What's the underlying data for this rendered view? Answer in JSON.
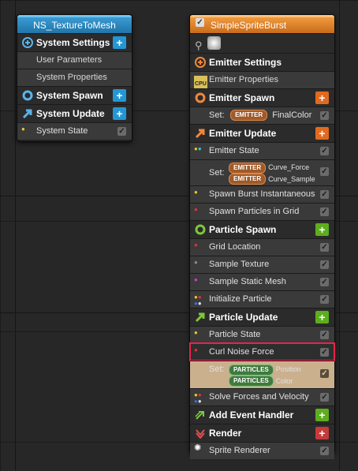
{
  "system_node": {
    "title": "NS_TextureToMesh",
    "rows": [
      {
        "kind": "header",
        "label": "System Settings",
        "icon": "system-settings-icon",
        "plus": true
      },
      {
        "kind": "plain",
        "label": "User Parameters"
      },
      {
        "kind": "plain",
        "label": "System Properties"
      },
      {
        "kind": "header",
        "label": "System Spawn",
        "icon": "system-spawn-icon",
        "plus": true
      },
      {
        "kind": "header",
        "label": "System Update",
        "icon": "system-update-icon",
        "plus": true
      },
      {
        "kind": "module",
        "label": "System State"
      }
    ]
  },
  "emitter_node": {
    "title": "SimpleSpriteBurst",
    "emitter_settings": "Emitter Settings",
    "emitter_properties": "Emitter Properties",
    "emitter_spawn": "Emitter Spawn",
    "set_label": "Set:",
    "spawn_set": {
      "badge": "EMITTER",
      "value": "FinalColor"
    },
    "emitter_update": "Emitter Update",
    "emitter_state": "Emitter State",
    "update_set": [
      {
        "badge": "EMITTER",
        "value": "Curve_Force"
      },
      {
        "badge": "EMITTER",
        "value": "Curve_Sample"
      }
    ],
    "spawn_burst": "Spawn Burst Instantaneous",
    "spawn_grid": "Spawn Particles in Grid",
    "particle_spawn": "Particle Spawn",
    "grid_location": "Grid Location",
    "sample_texture": "Sample Texture",
    "sample_static_mesh": "Sample Static Mesh",
    "initialize_particle": "Initialize Particle",
    "particle_update": "Particle Update",
    "particle_state": "Particle State",
    "curl_noise": "Curl Noise Force",
    "particles_set": [
      {
        "badge": "PARTICLES",
        "value": "Position"
      },
      {
        "badge": "PARTICLES",
        "value": "Color"
      }
    ],
    "solve_forces": "Solve Forces and Velocity",
    "add_event_handler": "Add Event Handler",
    "render": "Render",
    "sprite_renderer": "Sprite Renderer"
  }
}
